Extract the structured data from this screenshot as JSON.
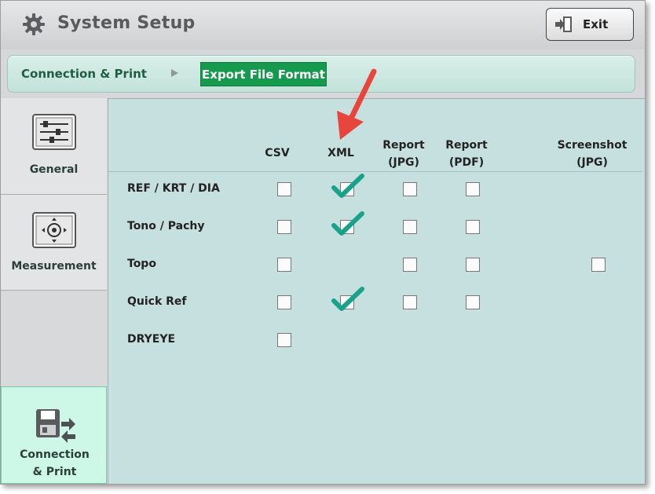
{
  "window": {
    "title": "System Setup"
  },
  "header": {
    "exit_label": "Exit"
  },
  "breadcrumb": {
    "parent": "Connection & Print",
    "current": "Export File Format"
  },
  "sidebar": {
    "items": [
      {
        "label": "General",
        "icon": "sliders-icon",
        "active": false
      },
      {
        "label": "Measurement",
        "icon": "measurement-icon",
        "active": false
      },
      {
        "label_line1": "Connection",
        "label_line2": "& Print",
        "icon": "connection-print-icon",
        "active": true
      }
    ]
  },
  "table": {
    "columns": [
      {
        "line1": "CSV",
        "line2": ""
      },
      {
        "line1": "XML",
        "line2": ""
      },
      {
        "line1": "Report",
        "line2": "(JPG)"
      },
      {
        "line1": "Report",
        "line2": "(PDF)"
      },
      {
        "line1": "Screenshot",
        "line2": "(JPG)"
      }
    ],
    "rows": [
      {
        "label": "REF / KRT / DIA",
        "cells": [
          "unchecked",
          "checked",
          "unchecked",
          "unchecked",
          "none"
        ]
      },
      {
        "label": "Tono / Pachy",
        "cells": [
          "unchecked",
          "checked",
          "unchecked",
          "unchecked",
          "none"
        ]
      },
      {
        "label": "Topo",
        "cells": [
          "unchecked",
          "none",
          "unchecked",
          "unchecked",
          "unchecked"
        ]
      },
      {
        "label": "Quick Ref",
        "cells": [
          "unchecked",
          "checked",
          "unchecked",
          "unchecked",
          "none"
        ]
      },
      {
        "label": "DRYEYE",
        "cells": [
          "unchecked",
          "none",
          "none",
          "none",
          "none"
        ]
      }
    ]
  },
  "colors": {
    "accent_green": "#169a4e",
    "check_teal": "#19a28a",
    "annotation_red": "#e8453c",
    "content_bg": "#c6e0df"
  }
}
